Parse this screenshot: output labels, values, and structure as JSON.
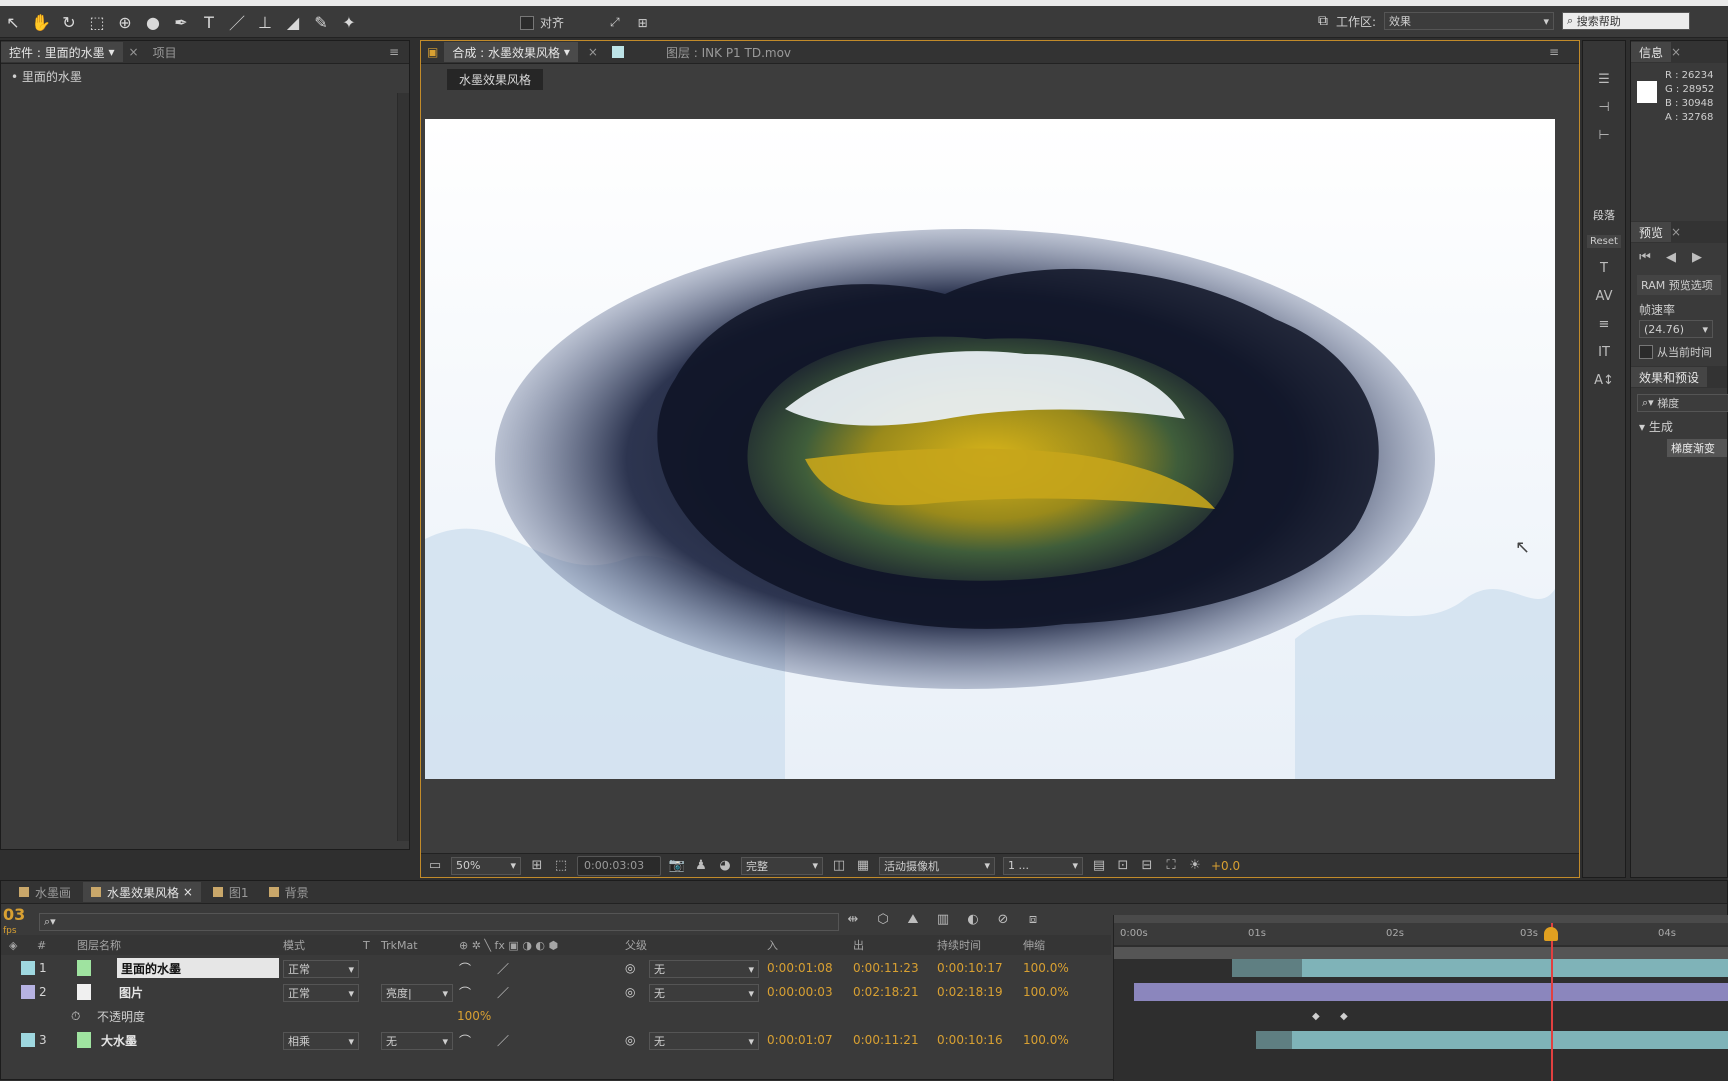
{
  "toolbar": {
    "snap_label": "对齐",
    "workspace_label": "工作区:",
    "workspace_value": "效果",
    "search_placeholder": "搜索帮助"
  },
  "left_panel": {
    "tab_controls": "控件 : 里面的水墨",
    "tab_project": "项目",
    "breadcrumb": "• 里面的水墨"
  },
  "composition": {
    "tab_comp": "合成 : 水墨效果风格",
    "tab_layer": "图层 : INK P1 TD.mov",
    "comp_badge": "水墨效果风格",
    "footer": {
      "zoom": "50%",
      "timecode": "0:00:03:03",
      "resolution": "完整",
      "camera": "活动摄像机",
      "views": "1 ...",
      "exposure": "+0.0"
    }
  },
  "right_panel": {
    "info_tab": "信息",
    "r": "R : 26234",
    "g": "G : 28952",
    "b": "B : 30948",
    "a": "A : 32768",
    "preview_tab": "预览",
    "ram_preview": "RAM 预览选项",
    "frame_rate_label": "帧速率",
    "frame_rate_value": "(24.76)",
    "from_current": "从当前时间",
    "effects_tab": "效果和预设",
    "effects_search": "梯度",
    "generate_group": "生成",
    "generate_item": "梯度渐变"
  },
  "side_strip": {
    "para_label": "段落",
    "reset_label": "Reset"
  },
  "timeline": {
    "tabs": [
      "水墨画",
      "水墨效果风格",
      "图1",
      "背景"
    ],
    "current_time": "03",
    "current_time_sub": "fps",
    "columns": {
      "num": "#",
      "name": "图层名称",
      "mode": "模式",
      "t": "T",
      "trkmat": "TrkMat",
      "parent": "父级",
      "in": "入",
      "out": "出",
      "duration": "持续时间",
      "stretch": "伸缩"
    },
    "ruler": [
      "0:00s",
      "01s",
      "02s",
      "03s",
      "04s"
    ],
    "layers": [
      {
        "num": "1",
        "name": "里面的水墨",
        "mode": "正常",
        "trkmat": "",
        "parent": "无",
        "in": "0:00:01:08",
        "out": "0:00:11:23",
        "duration": "0:00:10:17",
        "stretch": "100.0%",
        "color": "#9fd8e0"
      },
      {
        "num": "2",
        "name": "图片",
        "mode": "正常",
        "trkmat": "亮度|",
        "parent": "无",
        "in": "0:00:00:03",
        "out": "0:02:18:21",
        "duration": "0:02:18:19",
        "stretch": "100.0%",
        "color": "#b7b3e3"
      },
      {
        "num": "3",
        "name": "大水墨",
        "mode": "相乘",
        "trkmat": "无",
        "parent": "无",
        "in": "0:00:01:07",
        "out": "0:00:11:21",
        "duration": "0:00:10:16",
        "stretch": "100.0%",
        "color": "#9fd8e0"
      }
    ],
    "opacity_prop": "不透明度",
    "opacity_value": "100%"
  }
}
